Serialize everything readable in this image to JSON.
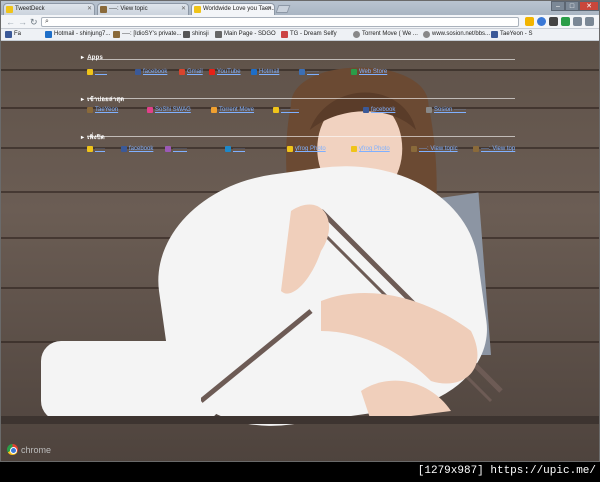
{
  "tabs": [
    {
      "label": "TweetDeck",
      "color": "#f0c419",
      "active": false
    },
    {
      "label": "----: View topic",
      "color": "#8a6a3a",
      "active": false
    },
    {
      "label": "Worldwide Love you Taen..",
      "color": "#f0c419",
      "active": true
    }
  ],
  "window_controls": {
    "min": "–",
    "max": "□",
    "close": "✕"
  },
  "toolbar": {
    "back": "←",
    "forward": "→",
    "reload": "↻",
    "url": ""
  },
  "bookmarks": [
    {
      "label": "Fa",
      "color": "#3b5998"
    },
    {
      "label": "Hotmail - shinjung7...",
      "color": "#1e6ec8"
    },
    {
      "label": "----: [IdioSY's private...",
      "color": "#8a6a3a"
    },
    {
      "label": "shinsji",
      "color": "#555"
    },
    {
      "label": "Main Page - SDGO",
      "color": "#666"
    },
    {
      "label": "TG - Dream Selfy",
      "color": "#c44"
    },
    {
      "label": "Torrent Move ( We ...",
      "color": "#888"
    },
    {
      "label": "www.sosion.net/bbs...",
      "color": "#888"
    },
    {
      "label": "TaeYeon - S",
      "color": "#3b5998"
    }
  ],
  "sections": [
    {
      "title": "Apps",
      "items": [
        {
          "label": "······",
          "color": "#f0c419"
        },
        {
          "label": "facebook",
          "color": "#3b5998"
        },
        {
          "label": "Gmail",
          "color": "#d9442d"
        },
        {
          "label": "YouTube",
          "color": "#e62117"
        },
        {
          "label": "Hotmail",
          "color": "#1e6ec8"
        },
        {
          "label": "······",
          "color": "#3b6fb6"
        },
        {
          "label": "Web Store",
          "color": "#2a9d48"
        }
      ]
    },
    {
      "title": "เข้าบ่อยล่าสุด",
      "items": [
        {
          "label": "TaeYeon",
          "color": "#8a6a3a"
        },
        {
          "label": "SoShi SWAG",
          "color": "#e2408a"
        },
        {
          "label": "Torrent Move",
          "color": "#f0a030"
        },
        {
          "label": "·········",
          "color": "#f0c419"
        },
        {
          "label": "facebook",
          "color": "#3b5998"
        },
        {
          "label": "Sosion ······",
          "color": "#888"
        }
      ]
    },
    {
      "title": "เพิ่งปิด",
      "items": [
        {
          "label": "·····",
          "color": "#f0c419"
        },
        {
          "label": "facebook",
          "color": "#3b5998"
        },
        {
          "label": "·······",
          "color": "#9b59b6"
        },
        {
          "label": "······",
          "color": "#1e88c8"
        },
        {
          "label": "yfrog Photo",
          "color": "#f0c419"
        },
        {
          "label": "yfrog Photo",
          "color": "#f0c419"
        },
        {
          "label": "----: View topic",
          "color": "#8a6a3a"
        },
        {
          "label": "----: View top",
          "color": "#8a6a3a"
        }
      ]
    }
  ],
  "brand": "chrome",
  "watermark": "[1279x987] https://upic.me/"
}
